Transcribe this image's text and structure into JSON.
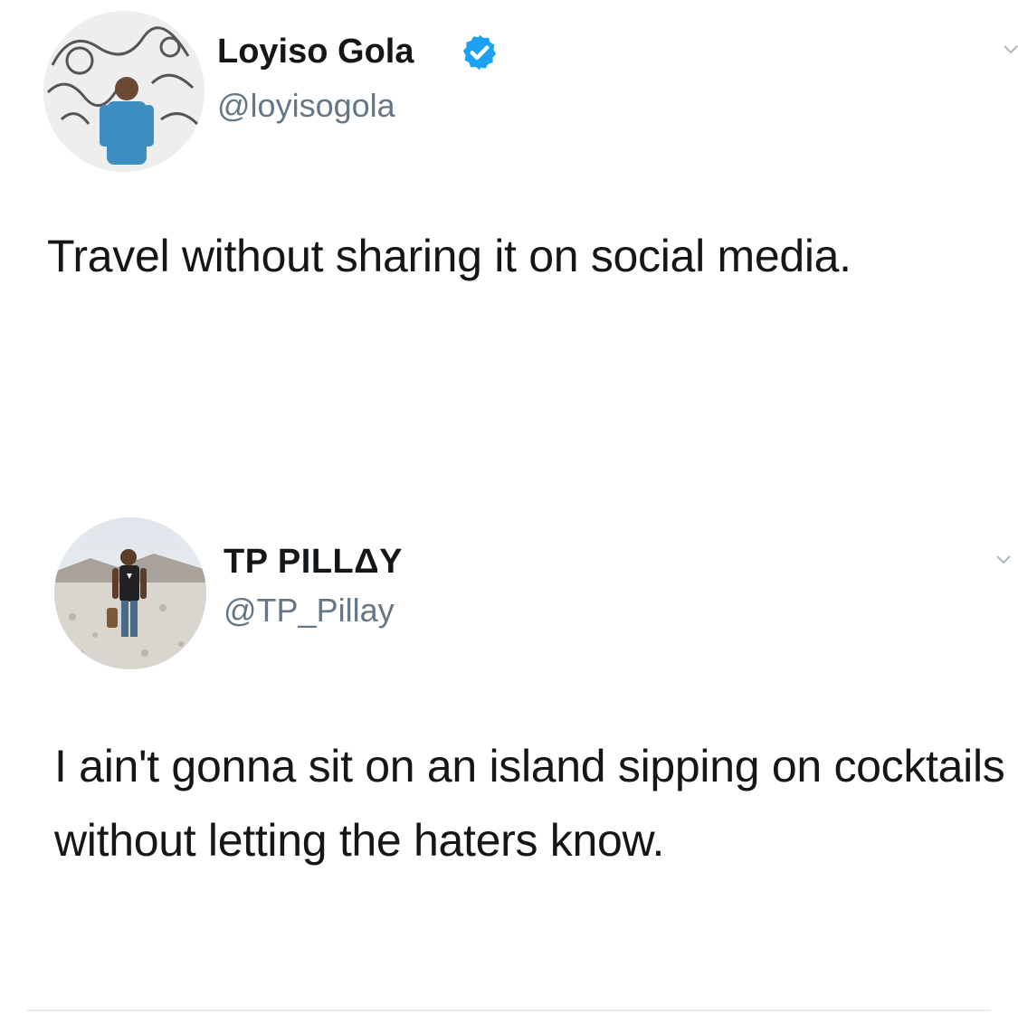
{
  "tweets": [
    {
      "display_name": "Loyiso Gola",
      "handle": "@loyisogola",
      "verified": true,
      "text": "Travel without sharing it on social media.",
      "avatar_icon": "profile-photo"
    },
    {
      "display_name": "TP PILLΔY",
      "handle": "@TP_Pillay",
      "verified": false,
      "text": "I ain't gonna sit on an island sipping on cocktails without letting the haters know.",
      "avatar_icon": "profile-photo"
    }
  ],
  "colors": {
    "text": "#14171a",
    "handle": "#657786",
    "verified_blue": "#1da1f2",
    "chevron": "#aab8c2"
  }
}
